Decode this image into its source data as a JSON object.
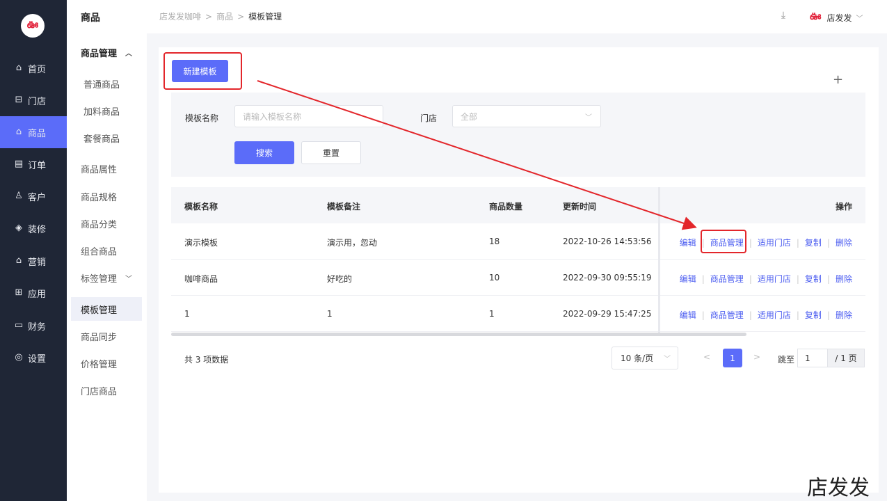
{
  "nav": {
    "logo": "ఊ",
    "items": [
      {
        "icon": "⌂",
        "label": "首页"
      },
      {
        "icon": "⊟",
        "label": "门店"
      },
      {
        "icon": "⌂",
        "label": "商品"
      },
      {
        "icon": "▤",
        "label": "订单"
      },
      {
        "icon": "♙",
        "label": "客户"
      },
      {
        "icon": "◈",
        "label": "装修"
      },
      {
        "icon": "⌂",
        "label": "营销"
      },
      {
        "icon": "⊞",
        "label": "应用"
      },
      {
        "icon": "▭",
        "label": "财务"
      },
      {
        "icon": "◎",
        "label": "设置"
      }
    ]
  },
  "subnav": {
    "title": "商品",
    "group1": "商品管理",
    "items": [
      "普通商品",
      "加料商品",
      "套餐商品",
      "商品属性",
      "商品规格",
      "商品分类",
      "组合商品"
    ],
    "group2": "标签管理",
    "items2": [
      "模板管理",
      "商品同步",
      "价格管理",
      "门店商品"
    ]
  },
  "header": {
    "crumb1": "店发发咖啡",
    "crumb2": "商品",
    "crumb3": "模板管理",
    "user": "店发发",
    "user_logo": "ఊ"
  },
  "toolbar": {
    "new_label": "新建模板",
    "plus": "+"
  },
  "filter": {
    "name_label": "模板名称",
    "name_placeholder": "请输入模板名称",
    "store_label": "门店",
    "store_value": "全部",
    "search_label": "搜索",
    "reset_label": "重置"
  },
  "table": {
    "headers": [
      "模板名称",
      "模板备注",
      "商品数量",
      "更新时间",
      "操作"
    ],
    "rows": [
      {
        "name": "演示模板",
        "note": "演示用，忽动",
        "count": "18",
        "time": "2022-10-26 14:53:56"
      },
      {
        "name": "咖啡商品",
        "note": "好吃的",
        "count": "10",
        "time": "2022-09-30 09:55:19"
      },
      {
        "name": "1",
        "note": "1",
        "count": "1",
        "time": "2022-09-29 15:47:25"
      }
    ],
    "actions": [
      "编辑",
      "商品管理",
      "适用门店",
      "复制",
      "删除"
    ]
  },
  "footer": {
    "total": "共 3 项数据",
    "page_size": "10 条/页",
    "current_page": "1",
    "jump_label": "跳至",
    "jump_value": "1",
    "total_pages": "/ 1 页"
  },
  "watermark": "店发发",
  "colors": {
    "accent": "#5b6cf9",
    "nav_bg": "#1f2636",
    "annotation_red": "#e3262b"
  }
}
